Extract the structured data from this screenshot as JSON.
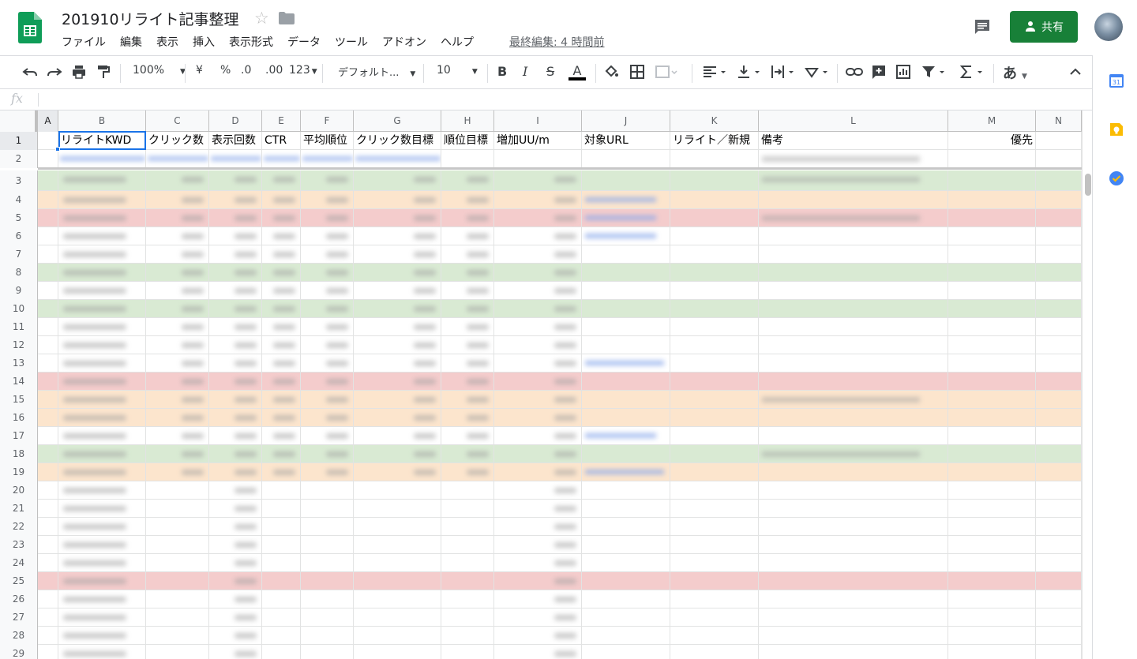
{
  "header": {
    "title": "201910リライト記事整理",
    "last_edit": "最終編集: 4 時間前",
    "share_label": "共有",
    "menu": [
      "ファイル",
      "編集",
      "表示",
      "挿入",
      "表示形式",
      "データ",
      "ツール",
      "アドオン",
      "ヘルプ"
    ]
  },
  "toolbar": {
    "zoom": "100%",
    "currency": "¥",
    "percent": "%",
    "dec_decrease": ".0",
    "dec_increase": ".00",
    "more_formats": "123",
    "font": "デフォルト...",
    "font_size": "10",
    "bold": "B",
    "italic": "I",
    "strike": "S",
    "text_color": "A",
    "input_tools": "あ"
  },
  "formula_bar": {
    "fx": "fx"
  },
  "grid": {
    "columns": [
      "A",
      "B",
      "C",
      "D",
      "E",
      "F",
      "G",
      "H",
      "I",
      "J",
      "K",
      "L",
      "M",
      "N"
    ],
    "headers": {
      "B": "リライトKWD",
      "C": "クリック数",
      "D": "表示回数",
      "E": "CTR",
      "F": "平均順位",
      "G": "クリック数目標",
      "H": "順位目標",
      "I": "増加UU/m",
      "J": "対象URL",
      "K": "リライト／新規",
      "L": "備考",
      "M": "優先"
    },
    "row_numbers": [
      "1",
      "2",
      "3",
      "4",
      "5",
      "6",
      "7",
      "8",
      "9",
      "10",
      "11",
      "12",
      "13",
      "14",
      "15",
      "16",
      "17",
      "18",
      "19",
      "20",
      "21",
      "22",
      "23",
      "24",
      "25",
      "26",
      "27",
      "28",
      "29"
    ],
    "row_colors": {
      "green": "#d9ead3",
      "orange": "#fce5cd",
      "red": "#f4cccc"
    }
  },
  "colors": {
    "share_green": "#188038",
    "selection_blue": "#1a73e8",
    "sheets_green": "#0f9d58"
  }
}
